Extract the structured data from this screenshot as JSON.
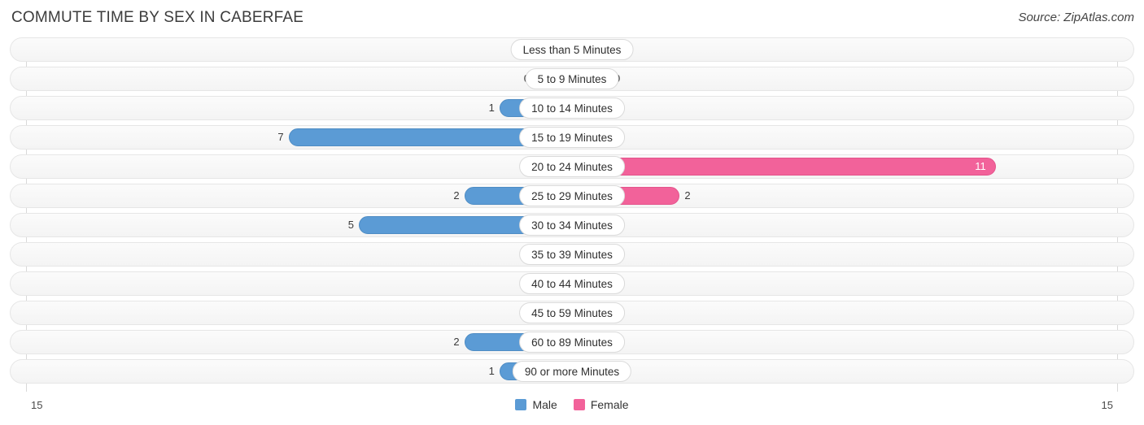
{
  "header": {
    "title": "COMMUTE TIME BY SEX IN CABERFAE",
    "source": "Source: ZipAtlas.com"
  },
  "legend": {
    "male_label": "Male",
    "female_label": "Female",
    "male_color": "#5b9bd5",
    "female_color": "#f2629a"
  },
  "axis": {
    "left_tick": "15",
    "right_tick": "15",
    "max": 15
  },
  "colors": {
    "male_strong": "#5b9bd5",
    "male_zero": "#aecbee",
    "female_strong": "#f2629a",
    "female_zero": "#f8a8c2",
    "row_background": "#f7f7f7",
    "row_border": "#e6e6e6",
    "pill_background": "#ffffff"
  },
  "chart_data": {
    "type": "bar",
    "orientation": "horizontal-diverging",
    "title": "COMMUTE TIME BY SEX IN CABERFAE",
    "xlabel": "",
    "ylabel": "",
    "xlim": [
      15,
      15
    ],
    "grid": false,
    "legend_position": "bottom-center",
    "categories": [
      "Less than 5 Minutes",
      "5 to 9 Minutes",
      "10 to 14 Minutes",
      "15 to 19 Minutes",
      "20 to 24 Minutes",
      "25 to 29 Minutes",
      "30 to 34 Minutes",
      "35 to 39 Minutes",
      "40 to 44 Minutes",
      "45 to 59 Minutes",
      "60 to 89 Minutes",
      "90 or more Minutes"
    ],
    "series": [
      {
        "name": "Male",
        "values": [
          0,
          0,
          1,
          7,
          0,
          2,
          5,
          0,
          0,
          0,
          2,
          1
        ]
      },
      {
        "name": "Female",
        "values": [
          0,
          0,
          0,
          0,
          11,
          2,
          0,
          0,
          0,
          0,
          0,
          0
        ]
      }
    ]
  },
  "rows": [
    {
      "label": "Less than 5 Minutes",
      "male": "0",
      "female": "0"
    },
    {
      "label": "5 to 9 Minutes",
      "male": "0",
      "female": "0"
    },
    {
      "label": "10 to 14 Minutes",
      "male": "1",
      "female": "0"
    },
    {
      "label": "15 to 19 Minutes",
      "male": "7",
      "female": "0"
    },
    {
      "label": "20 to 24 Minutes",
      "male": "0",
      "female": "11"
    },
    {
      "label": "25 to 29 Minutes",
      "male": "2",
      "female": "2"
    },
    {
      "label": "30 to 34 Minutes",
      "male": "5",
      "female": "0"
    },
    {
      "label": "35 to 39 Minutes",
      "male": "0",
      "female": "0"
    },
    {
      "label": "40 to 44 Minutes",
      "male": "0",
      "female": "0"
    },
    {
      "label": "45 to 59 Minutes",
      "male": "0",
      "female": "0"
    },
    {
      "label": "60 to 89 Minutes",
      "male": "2",
      "female": "0"
    },
    {
      "label": "90 or more Minutes",
      "male": "1",
      "female": "0"
    }
  ]
}
